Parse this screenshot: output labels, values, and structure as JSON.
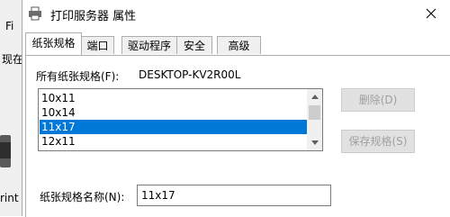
{
  "background_window": {
    "text_1": "Fi",
    "text_2": "现在",
    "text_3": "rint"
  },
  "dialog": {
    "title": "打印服务器 属性",
    "tabs": [
      {
        "label": "纸张规格",
        "active": true
      },
      {
        "label": "端口",
        "active": false
      },
      {
        "label": "驱动程序",
        "active": false
      },
      {
        "label": "安全",
        "active": false
      },
      {
        "label": "高级",
        "active": false
      }
    ],
    "forms_label": "所有纸张规格(F):",
    "computer_name": "DESKTOP-KV2R00L",
    "forms_list": [
      {
        "label": "10x11",
        "selected": false
      },
      {
        "label": "10x14",
        "selected": false
      },
      {
        "label": "11x17",
        "selected": true
      },
      {
        "label": "12x11",
        "selected": false
      }
    ],
    "delete_button": "删除(D)",
    "save_button": "保存规格(S)",
    "form_name_label": "纸张规格名称(N):",
    "form_name_value": "11x17"
  },
  "colors": {
    "selection": "#0078d7",
    "disabled_text": "#a0a0a0"
  }
}
